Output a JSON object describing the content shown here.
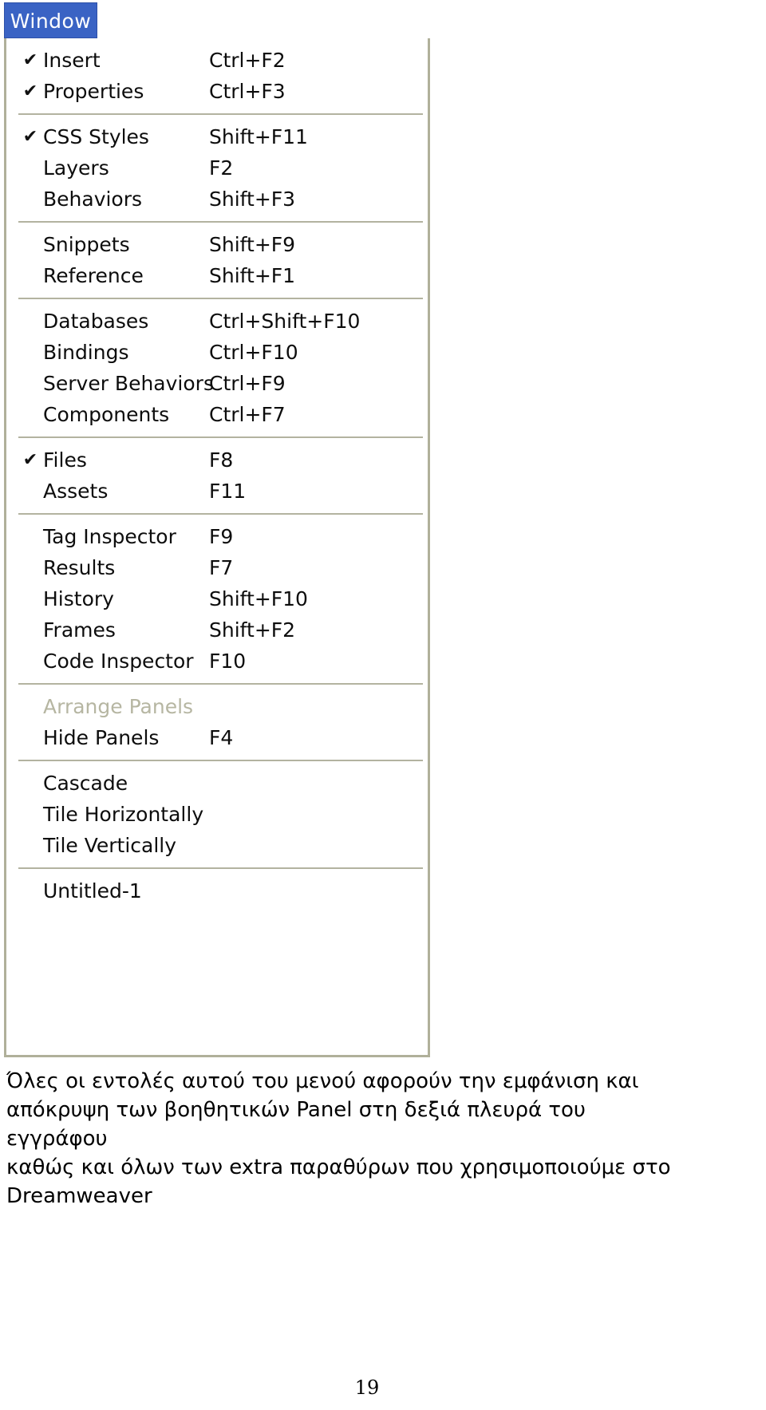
{
  "menu": {
    "title": "Window",
    "title_bar_color": "#3a63c4",
    "title_text_color": "#ffffff",
    "border_color": "#b0b09a",
    "check_glyph": "✔",
    "groups": [
      {
        "items": [
          {
            "label": "Insert",
            "shortcut": "Ctrl+F2",
            "checked": true,
            "disabled": false
          },
          {
            "label": "Properties",
            "shortcut": "Ctrl+F3",
            "checked": true,
            "disabled": false
          }
        ]
      },
      {
        "items": [
          {
            "label": "CSS Styles",
            "shortcut": "Shift+F11",
            "checked": true,
            "disabled": false
          },
          {
            "label": "Layers",
            "shortcut": "F2",
            "checked": false,
            "disabled": false
          },
          {
            "label": "Behaviors",
            "shortcut": "Shift+F3",
            "checked": false,
            "disabled": false
          }
        ]
      },
      {
        "items": [
          {
            "label": "Snippets",
            "shortcut": "Shift+F9",
            "checked": false,
            "disabled": false
          },
          {
            "label": "Reference",
            "shortcut": "Shift+F1",
            "checked": false,
            "disabled": false
          }
        ]
      },
      {
        "items": [
          {
            "label": "Databases",
            "shortcut": "Ctrl+Shift+F10",
            "checked": false,
            "disabled": false
          },
          {
            "label": "Bindings",
            "shortcut": "Ctrl+F10",
            "checked": false,
            "disabled": false
          },
          {
            "label": "Server Behaviors",
            "shortcut": "Ctrl+F9",
            "checked": false,
            "disabled": false
          },
          {
            "label": "Components",
            "shortcut": "Ctrl+F7",
            "checked": false,
            "disabled": false
          }
        ]
      },
      {
        "items": [
          {
            "label": "Files",
            "shortcut": "F8",
            "checked": true,
            "disabled": false
          },
          {
            "label": "Assets",
            "shortcut": "F11",
            "checked": false,
            "disabled": false
          }
        ]
      },
      {
        "items": [
          {
            "label": "Tag Inspector",
            "shortcut": "F9",
            "checked": false,
            "disabled": false
          },
          {
            "label": "Results",
            "shortcut": "F7",
            "checked": false,
            "disabled": false
          },
          {
            "label": "History",
            "shortcut": "Shift+F10",
            "checked": false,
            "disabled": false
          },
          {
            "label": "Frames",
            "shortcut": "Shift+F2",
            "checked": false,
            "disabled": false
          },
          {
            "label": "Code Inspector",
            "shortcut": "F10",
            "checked": false,
            "disabled": false
          }
        ]
      },
      {
        "items": [
          {
            "label": "Arrange Panels",
            "shortcut": "",
            "checked": false,
            "disabled": true
          },
          {
            "label": "Hide Panels",
            "shortcut": "F4",
            "checked": false,
            "disabled": false
          }
        ]
      },
      {
        "items": [
          {
            "label": "Cascade",
            "shortcut": "",
            "checked": false,
            "disabled": false
          },
          {
            "label": "Tile Horizontally",
            "shortcut": "",
            "checked": false,
            "disabled": false
          },
          {
            "label": "Tile Vertically",
            "shortcut": "",
            "checked": false,
            "disabled": false
          }
        ]
      },
      {
        "items": [
          {
            "label": "Untitled-1",
            "shortcut": "",
            "checked": false,
            "disabled": false
          }
        ]
      }
    ]
  },
  "caption": {
    "lines": [
      "Όλες οι εντολές αυτού του μενού αφορούν την εμφάνιση και",
      "απόκρυψη των βοηθητικών Panel στη δεξιά πλευρά του εγγράφου",
      "καθώς και όλων των extra παραθύρων που χρησιμοποιούμε στο",
      "Dreamweaver"
    ]
  },
  "page": {
    "number": "19"
  }
}
